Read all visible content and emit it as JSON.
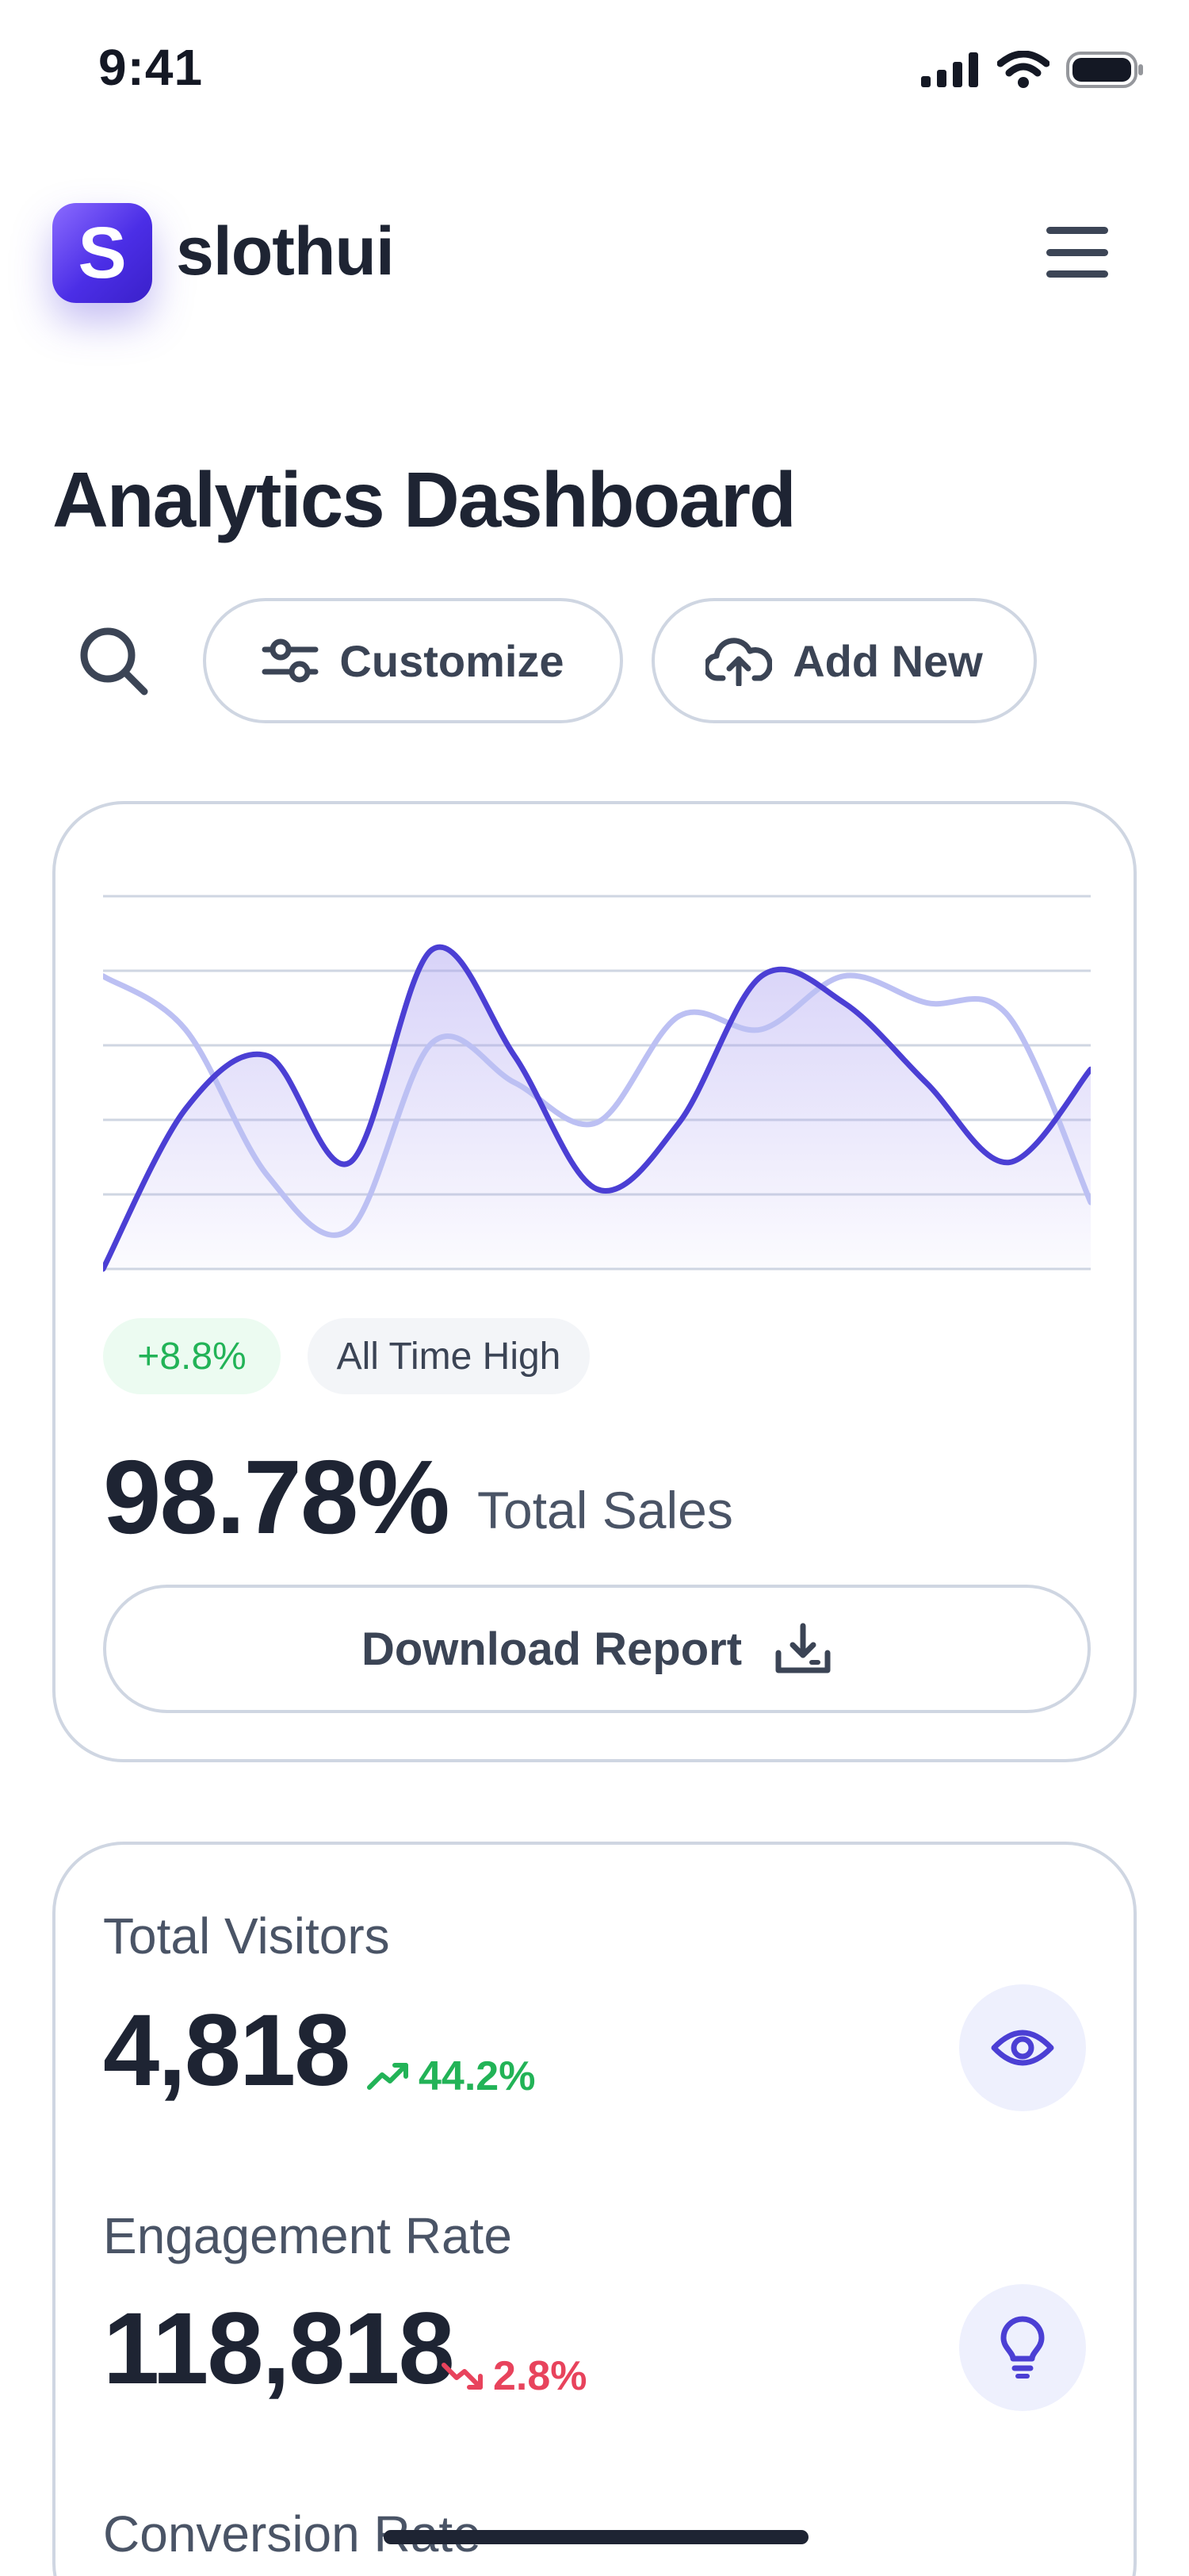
{
  "status_bar": {
    "time": "9:41"
  },
  "header": {
    "logo_letter": "S",
    "brand": "slothui"
  },
  "page": {
    "title": "Analytics Dashboard"
  },
  "actions": {
    "customize": "Customize",
    "add_new": "Add New"
  },
  "sales_card": {
    "change_badge": "+8.8%",
    "status_badge": "All Time High",
    "value": "98.78%",
    "value_label": "Total Sales",
    "download_label": "Download Report"
  },
  "stats": [
    {
      "label": "Total Visitors",
      "value": "4,818",
      "change": "44.2%",
      "direction": "up",
      "icon": "eye-icon"
    },
    {
      "label": "Engagement Rate",
      "value": "118,818",
      "change": "2.8%",
      "direction": "down",
      "icon": "lightbulb-icon"
    },
    {
      "label": "Conversion Rate"
    }
  ],
  "colors": {
    "accent": "#4b3fd4",
    "accent_light": "#bcc0f3",
    "positive": "#22b357",
    "negative": "#e8435c",
    "text_dark": "#1e2433",
    "border": "#cfd6e2"
  },
  "chart_data": {
    "type": "area",
    "x": [
      0,
      1,
      2,
      3,
      4,
      5,
      6,
      7,
      8,
      9,
      10,
      11,
      12
    ],
    "series": [
      {
        "values": [
          0,
          60,
          80,
          40,
          120,
          80,
          30,
          55,
          110,
          100,
          70,
          40,
          75
        ]
      },
      {
        "values": [
          110,
          90,
          35,
          15,
          85,
          70,
          55,
          95,
          90,
          110,
          100,
          95,
          25
        ]
      }
    ],
    "ylim": [
      0,
      140
    ],
    "grid": true,
    "legend": "none"
  }
}
